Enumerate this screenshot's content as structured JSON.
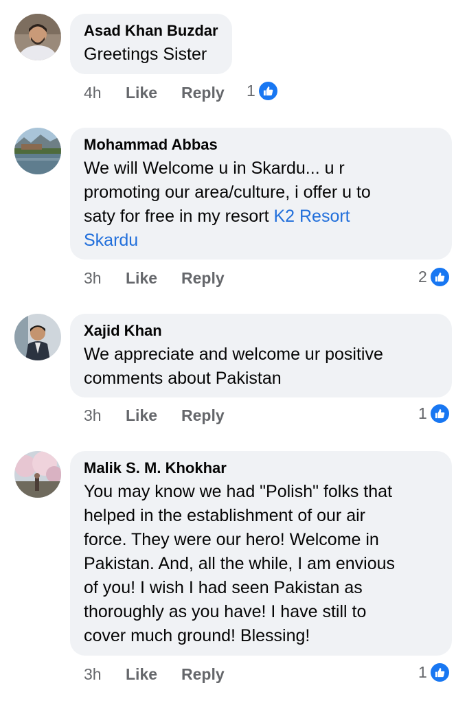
{
  "comments": [
    {
      "author": "Asad Khan Buzdar",
      "text": "Greetings Sister",
      "time": "4h",
      "like_label": "Like",
      "reply_label": "Reply",
      "reaction_count": "1",
      "reaction_icon": "like-icon"
    },
    {
      "author": "Mohammad Abbas",
      "text": "We will Welcome u in Skardu... u r\npromoting our area/culture,  i offer u to\nsaty for free in my resort ",
      "link_text": "K2 Resort\nSkardu",
      "time": "3h",
      "like_label": "Like",
      "reply_label": "Reply",
      "reaction_count": "2",
      "reaction_icon": "like-icon"
    },
    {
      "author": "Xajid Khan",
      "text": "We appreciate and welcome ur positive\ncomments about Pakistan",
      "time": "3h",
      "like_label": "Like",
      "reply_label": "Reply",
      "reaction_count": "1",
      "reaction_icon": "like-icon"
    },
    {
      "author": "Malik S. M. Khokhar",
      "text": "You may know we had \"Polish\" folks that\nhelped in the establishment of our air\nforce. They were our hero! Welcome in\nPakistan. And, all the while, I am envious\nof you! I wish I had seen Pakistan as\nthoroughly as you have! I have still to\ncover much ground! Blessing!",
      "time": "3h",
      "like_label": "Like",
      "reply_label": "Reply",
      "reaction_count": "1",
      "reaction_icon": "like-icon"
    }
  ],
  "colors": {
    "bubble": "#f0f2f5",
    "meta_text": "#65676b",
    "link": "#216fdb",
    "like_badge": "#1877f2"
  }
}
